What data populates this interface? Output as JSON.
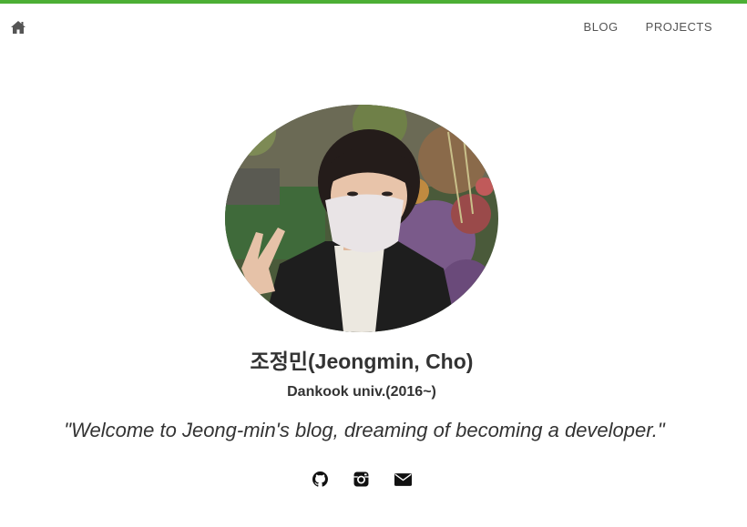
{
  "nav": {
    "home_icon": "home-icon",
    "links": [
      {
        "label": "BLOG"
      },
      {
        "label": "PROJECTS"
      }
    ]
  },
  "profile": {
    "avatar_alt": "profile photo",
    "name": "조정민(Jeongmin, Cho)",
    "school": "Dankook univ.(2016~)",
    "tagline": "\"Welcome to Jeong-min's blog, dreaming of becoming a developer.\""
  },
  "social": [
    {
      "icon": "github-icon"
    },
    {
      "icon": "instagram-icon"
    },
    {
      "icon": "envelope-icon"
    }
  ],
  "colors": {
    "accent": "#4caf35",
    "text": "#333333",
    "nav_text": "#555555"
  }
}
